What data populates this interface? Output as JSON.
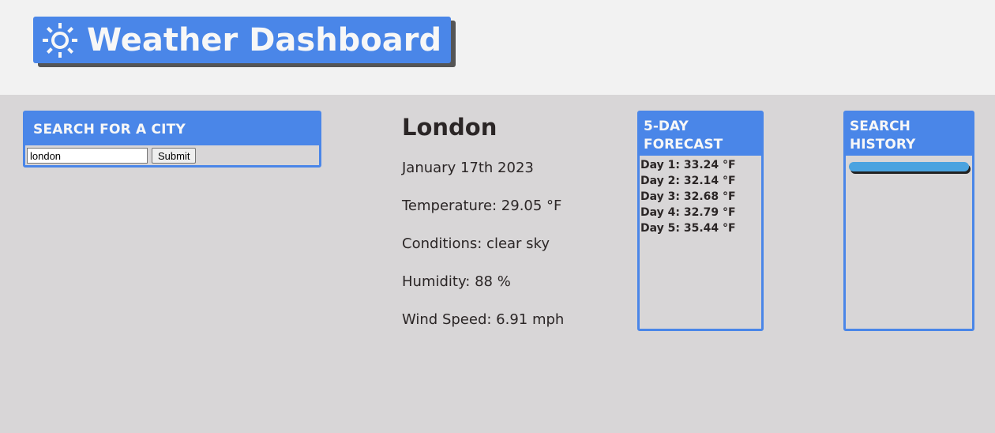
{
  "header": {
    "title": "Weather Dashboard",
    "icon": "sun-icon"
  },
  "search": {
    "heading": "SEARCH FOR A CITY",
    "input_value": "london",
    "button_label": "Submit"
  },
  "current": {
    "city": "London",
    "date": "January 17th 2023",
    "temperature": "Temperature: 29.05 °F",
    "conditions": "Conditions: clear sky",
    "humidity": "Humidity: 88 %",
    "wind": "Wind Speed: 6.91 mph"
  },
  "forecast": {
    "heading": "5-DAY FORECAST",
    "days": [
      "Day 1: 33.24 °F",
      "Day 2: 32.14 °F",
      "Day 3: 32.68 °F",
      "Day 4: 32.79 °F",
      "Day 5: 35.44 °F"
    ]
  },
  "history": {
    "heading": "SEARCH HISTORY",
    "items": [
      ""
    ]
  },
  "colors": {
    "accent": "#4a86e8",
    "background": "#d8d6d7",
    "header_bg": "#f2f2f2",
    "history_button": "#4aa3e0"
  }
}
